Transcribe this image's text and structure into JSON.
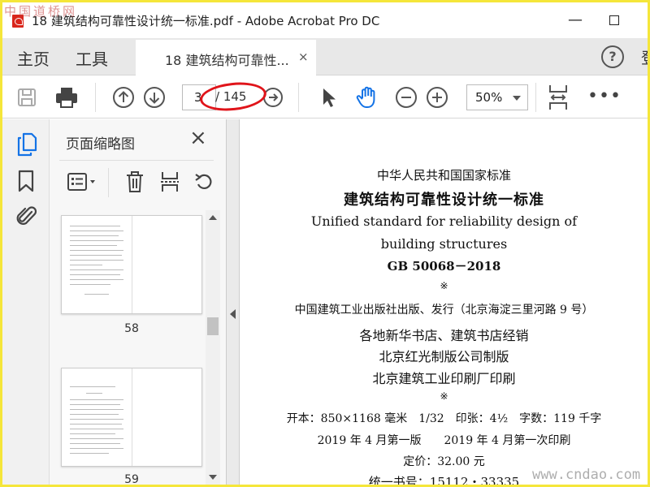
{
  "window": {
    "title": "18 建筑结构可靠性设计统一标准.pdf - Adobe Acrobat Pro DC",
    "watermark_top": "中国道桥网",
    "minimize_symbol": "—"
  },
  "nav": {
    "home": "主页",
    "tools": "工具",
    "tab_label": "18 建筑结构可靠性...",
    "tab_close": "×",
    "help": "?",
    "signin": "登"
  },
  "toolbar": {
    "current_page": "3",
    "total_pages": "/ 145",
    "zoom": "50%",
    "more": "•••"
  },
  "panel": {
    "title": "页面缩略图",
    "close": "×",
    "thumbnails": [
      {
        "page": "58"
      },
      {
        "page": "59"
      }
    ]
  },
  "document": {
    "lines": [
      "中华人民共和国国家标准",
      "建筑结构可靠性设计统一标准",
      "Unified standard for reliability design of",
      "building structures",
      "GB 50068－2018",
      "※",
      "中国建筑工业出版社出版、发行（北京海淀三里河路 9 号）",
      "各地新华书店、建筑书店经销",
      "北京红光制版公司制版",
      "北京建筑工业印刷厂印刷",
      "※",
      "开本：850×1168 毫米　1/32　印张：4½　字数：119 千字",
      "2019 年 4 月第一版　　2019 年 4 月第一次印刷",
      "定价：32.00 元",
      "统一书号：15112・33335"
    ]
  },
  "watermark_bottom": "www.cndao.com",
  "colors": {
    "accent_blue": "#1473e6",
    "annotation_red": "#e0141a",
    "frame_yellow": "#f5e63a"
  }
}
